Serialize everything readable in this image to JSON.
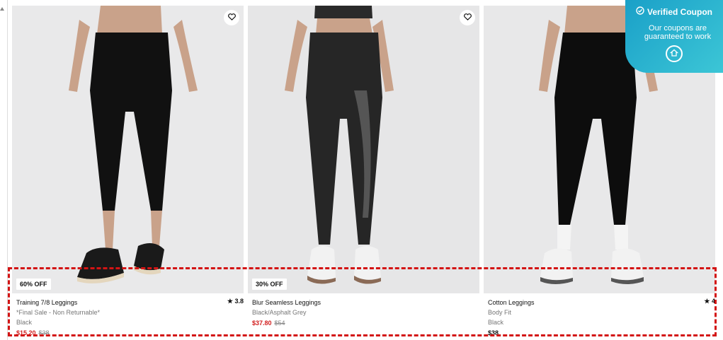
{
  "products": [
    {
      "badge": "60% OFF",
      "name": "Training 7/8 Leggings",
      "note": "*Final Sale - Non Returnable*",
      "color": "Black",
      "price_now": "$15.20",
      "price_was": "$38",
      "rating": "3.8"
    },
    {
      "badge": "30% OFF",
      "name": "Blur Seamless Leggings",
      "color": "Black/Asphalt Grey",
      "price_now": "$37.80",
      "price_was": "$54"
    },
    {
      "name": "Cotton Leggings",
      "note": "Body Fit",
      "color": "Black",
      "price": "$38",
      "rating": "4"
    }
  ],
  "coupon": {
    "title": "Verified Coupon",
    "description": "Our coupons are guaranteed to work"
  },
  "colors": {
    "sale_red": "#d21f1f",
    "highlight_red": "#d31414",
    "coupon_teal": "#1aa0c8"
  },
  "icons": [
    "heart-icon",
    "star-icon",
    "check-circle-icon",
    "home-icon"
  ]
}
